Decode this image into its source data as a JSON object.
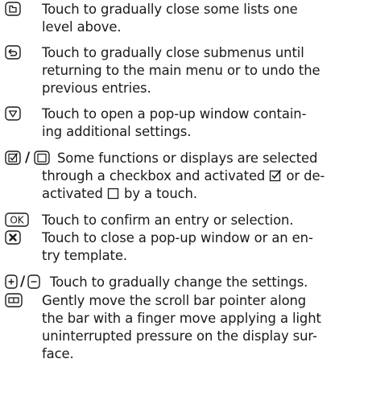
{
  "entries": [
    {
      "icon": "list-up-icon",
      "lines": [
        "Touch to gradually close some lists one",
        "level above."
      ]
    },
    {
      "icon": "back-icon",
      "lines": [
        "Touch to gradually close submenus until",
        "returning to the main menu or to undo the",
        "previous entries."
      ]
    },
    {
      "icon": "dropdown-icon",
      "lines": [
        "Touch to open a pop-up window contain-",
        "ing additional settings."
      ]
    },
    {
      "icon": "checkbox-icon",
      "separator": "/",
      "lines_rich": [
        {
          "parts": [
            "Some functions or displays are selected"
          ]
        },
        {
          "parts": [
            "through a checkbox and activated",
            " or de-"
          ]
        },
        {
          "parts": [
            "activated",
            " by a touch."
          ]
        }
      ]
    },
    {
      "icon": "ok-button-icon",
      "lines": [
        "Touch to confirm an entry or selection."
      ]
    },
    {
      "icon": "close-icon",
      "lines": [
        "Touch to close a pop-up window or an en-",
        "try template."
      ]
    },
    {
      "icon": "plus-minus-icon",
      "separator": "/",
      "lines": [
        "Touch to gradually change the settings."
      ]
    },
    {
      "icon": "scrollbar-icon",
      "lines": [
        "Gently move the scroll bar pointer along",
        "the bar with a finger move applying a light",
        "uninterrupted pressure on the display sur-",
        "face."
      ]
    }
  ]
}
